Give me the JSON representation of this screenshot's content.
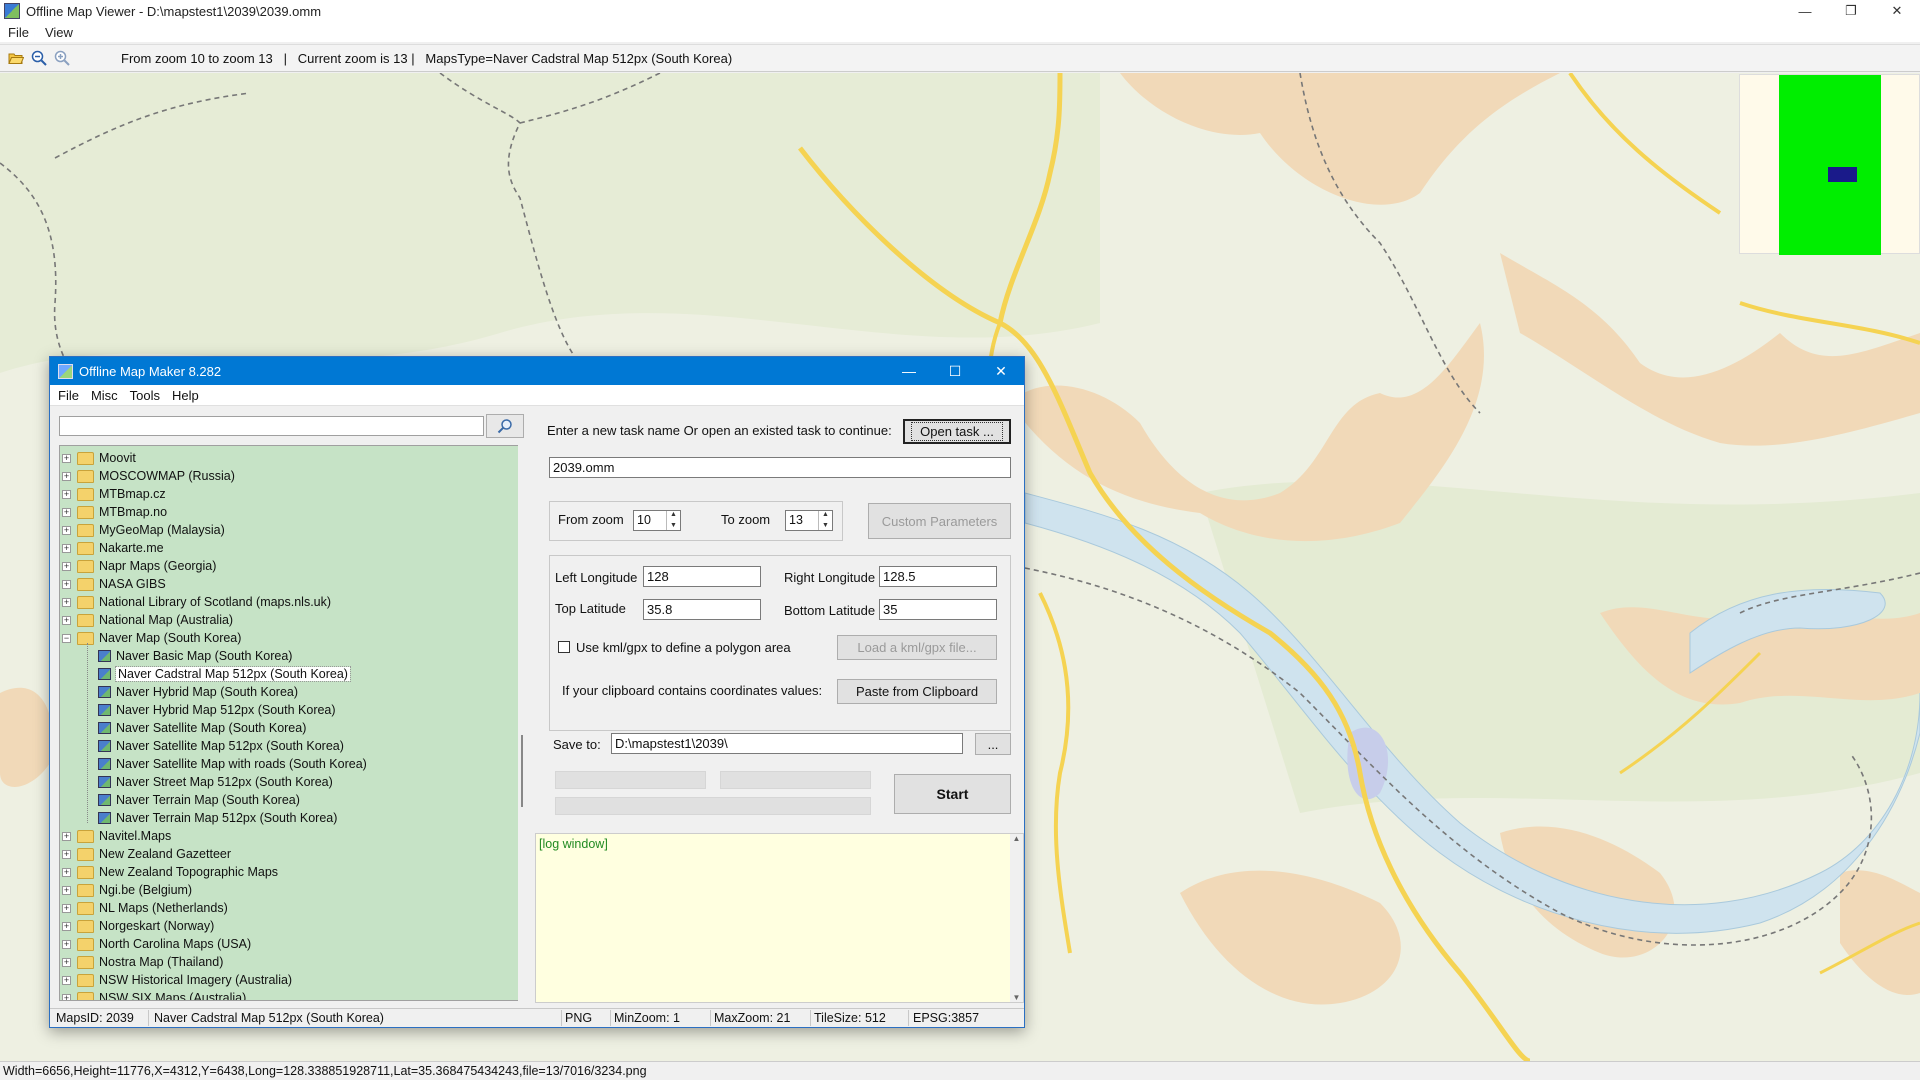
{
  "viewer": {
    "title": "Offline Map Viewer - D:\\mapstest1\\2039\\2039.omm",
    "menu": [
      "File",
      "View"
    ],
    "toolbar_info": "From zoom 10 to zoom 13   |   Current zoom is 13 |   MapsType=Naver Cadstral Map 512px (South Korea)",
    "window_buttons": [
      "—",
      "❐",
      "✕"
    ],
    "status": "Width=6656,Height=11776,X=4312,Y=6438,Long=128.338851928711,Lat=35.368475434243,file=13/7016/3234.png"
  },
  "minimap": {
    "colors": {
      "background": "#fffaea",
      "extent": "#00ee00",
      "view": "#1a1a8a"
    }
  },
  "dialog": {
    "title": "Offline Map Maker 8.282",
    "window_buttons": [
      "—",
      "☐",
      "✕"
    ],
    "menu": [
      "File",
      "Misc",
      "Tools",
      "Help"
    ],
    "search": {
      "value": ""
    },
    "tree": [
      {
        "label": "Moovit",
        "kind": "folder"
      },
      {
        "label": "MOSCOWMAP (Russia)",
        "kind": "folder"
      },
      {
        "label": "MTBmap.cz",
        "kind": "folder"
      },
      {
        "label": "MTBmap.no",
        "kind": "folder"
      },
      {
        "label": "MyGeoMap (Malaysia)",
        "kind": "folder"
      },
      {
        "label": "Nakarte.me",
        "kind": "folder"
      },
      {
        "label": "Napr Maps (Georgia)",
        "kind": "folder"
      },
      {
        "label": "NASA GIBS",
        "kind": "folder"
      },
      {
        "label": "National Library of Scotland (maps.nls.uk)",
        "kind": "folder"
      },
      {
        "label": "National Map (Australia)",
        "kind": "folder"
      },
      {
        "label": "Naver Map (South Korea)",
        "kind": "folder-open"
      },
      {
        "label": "Naver Basic Map (South Korea)",
        "kind": "map"
      },
      {
        "label": "Naver Cadstral Map 512px (South Korea)",
        "kind": "map",
        "selected": true
      },
      {
        "label": "Naver Hybrid Map (South Korea)",
        "kind": "map"
      },
      {
        "label": "Naver Hybrid Map 512px (South Korea)",
        "kind": "map"
      },
      {
        "label": "Naver Satellite Map (South Korea)",
        "kind": "map"
      },
      {
        "label": "Naver Satellite Map 512px (South Korea)",
        "kind": "map"
      },
      {
        "label": "Naver Satellite Map with roads (South Korea)",
        "kind": "map"
      },
      {
        "label": "Naver Street Map 512px (South Korea)",
        "kind": "map"
      },
      {
        "label": "Naver Terrain Map (South Korea)",
        "kind": "map"
      },
      {
        "label": "Naver Terrain Map 512px (South Korea)",
        "kind": "map"
      },
      {
        "label": "Navitel.Maps",
        "kind": "folder"
      },
      {
        "label": "New Zealand Gazetteer",
        "kind": "folder"
      },
      {
        "label": "New Zealand Topographic Maps",
        "kind": "folder"
      },
      {
        "label": "Ngi.be (Belgium)",
        "kind": "folder"
      },
      {
        "label": "NL Maps (Netherlands)",
        "kind": "folder"
      },
      {
        "label": "Norgeskart (Norway)",
        "kind": "folder"
      },
      {
        "label": "North Carolina Maps (USA)",
        "kind": "folder"
      },
      {
        "label": "Nostra Map (Thailand)",
        "kind": "folder"
      },
      {
        "label": "NSW Historical Imagery (Australia)",
        "kind": "folder"
      },
      {
        "label": "NSW SIX Maps (Australia)",
        "kind": "folder"
      }
    ],
    "task": {
      "prompt": "Enter a new task name Or open an existed task to continue:",
      "open_button": "Open task ...",
      "name_value": "2039.omm"
    },
    "zoom": {
      "from_label": "From zoom",
      "from_value": "10",
      "to_label": "To zoom",
      "to_value": "13",
      "custom_button": "Custom Parameters"
    },
    "bounds": {
      "left_label": "Left Longitude",
      "left_value": "128",
      "right_label": "Right Longitude",
      "right_value": "128.5",
      "top_label": "Top Latitude",
      "top_value": "35.8",
      "bottom_label": "Bottom Latitude",
      "bottom_value": "35",
      "kml_checkbox_label": "Use kml/gpx to define a polygon area",
      "kml_checked": false,
      "load_kml_button": "Load a kml/gpx file...",
      "clipboard_label": "If your clipboard contains coordinates values:",
      "paste_button": "Paste from Clipboard"
    },
    "save": {
      "label": "Save to:",
      "value": "D:\\mapstest1\\2039\\",
      "browse_button": "..."
    },
    "start_button": "Start",
    "log": "[log window]",
    "status": {
      "maps_id": "MapsID: 2039",
      "map_name": "Naver Cadstral Map 512px (South Korea)",
      "format": "PNG",
      "min_zoom": "MinZoom: 1",
      "max_zoom": "MaxZoom: 21",
      "tile_size": "TileSize: 512",
      "epsg": "EPSG:3857"
    }
  },
  "map_colors": {
    "land": "#eef0e2",
    "terrain": "#f1d9b8",
    "forest": "#dfe8cf",
    "water": "#cfe3ee",
    "road": "#f5d352",
    "boundary": "#777777"
  }
}
